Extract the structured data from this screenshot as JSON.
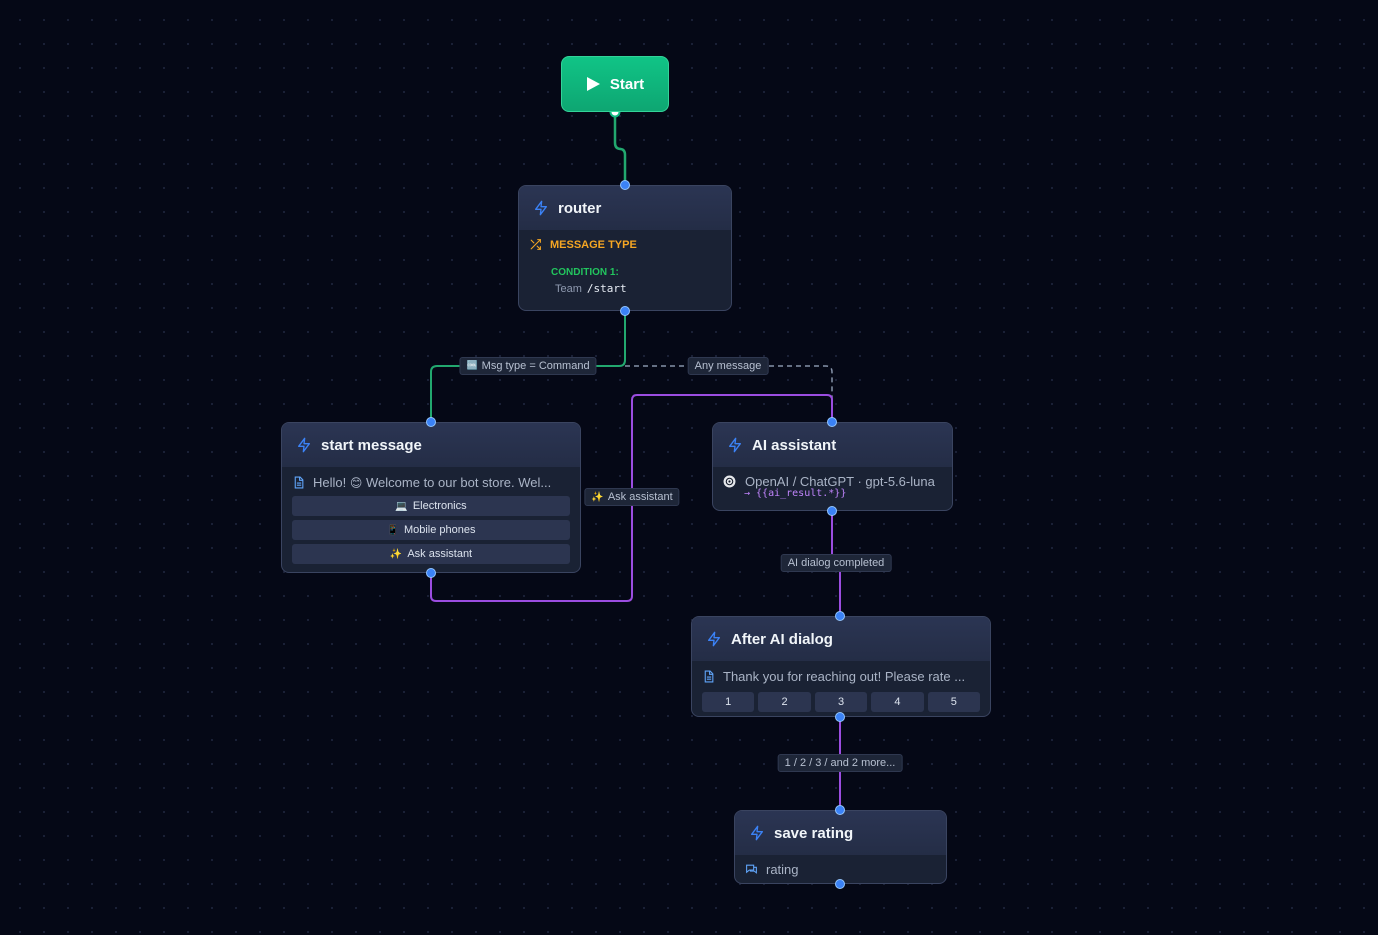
{
  "start": {
    "label": "Start"
  },
  "nodes": {
    "router": {
      "title": "router",
      "section_label": "MESSAGE TYPE",
      "condition_label": "CONDITION 1:",
      "condition_field": "Team",
      "condition_value": "/start"
    },
    "start_message": {
      "title": "start message",
      "message_prefix": "Hello!",
      "message_emoji": "😊",
      "message_text": "Welcome to our bot store. Wel...",
      "buttons": [
        {
          "icon": "💻",
          "label": "Electronics"
        },
        {
          "icon": "📱",
          "label": "Mobile phones"
        },
        {
          "icon": "✨",
          "label": "Ask assistant"
        }
      ]
    },
    "ai_assistant": {
      "title": "AI assistant",
      "provider": "OpenAI / ChatGPT · gpt-5.6-luna",
      "output_var": "→ {{ai_result.*}}"
    },
    "after_ai": {
      "title": "After AI dialog",
      "message_text": "Thank you for reaching out! Please rate ...",
      "options": [
        "1",
        "2",
        "3",
        "4",
        "5"
      ]
    },
    "save_rating": {
      "title": "save rating",
      "variable": "rating"
    }
  },
  "edge_labels": {
    "command": {
      "icon": "🆒",
      "text": "Msg type = Command"
    },
    "any": {
      "text": "Any message"
    },
    "ask": {
      "icon": "✨",
      "text": "Ask assistant"
    },
    "ai_done": {
      "text": "AI dialog completed"
    },
    "rating": {
      "text": "1 / 2 / 3 / and 2 more..."
    }
  },
  "colors": {
    "green_edge": "#22a86f",
    "purple_edge": "#9b4de0",
    "dashed_edge": "#8592a8",
    "handle": "#3b82f6",
    "accent_orange": "#f5a623",
    "accent_green": "#22c55e"
  }
}
